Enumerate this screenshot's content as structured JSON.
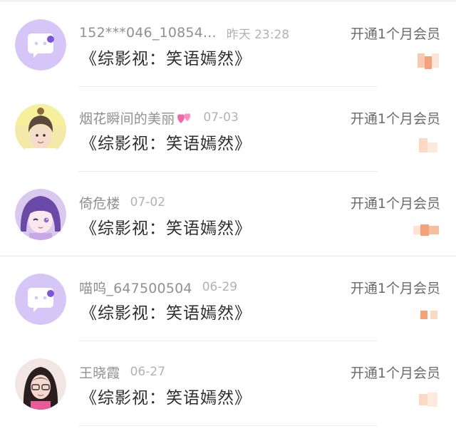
{
  "records": [
    {
      "username": "152***046_10854...",
      "timestamp": "昨天 23:28",
      "title": "《综影视：笑语嫣然》",
      "action": "开通1个月会员",
      "avatar": "default-chat-icon",
      "has_heart": false
    },
    {
      "username": "烟花瞬间的美丽",
      "timestamp": "07-03",
      "title": "《综影视：笑语嫣然》",
      "action": "开通1个月会员",
      "avatar": "user-photo",
      "has_heart": true
    },
    {
      "username": "倚危楼",
      "timestamp": "07-02",
      "title": "《综影视：笑语嫣然》",
      "action": "开通1个月会员",
      "avatar": "anime-girl",
      "has_heart": false
    },
    {
      "username": "喵呜_647500504",
      "timestamp": "06-29",
      "title": "《综影视：笑语嫣然》",
      "action": "开通1个月会员",
      "avatar": "default-chat-icon",
      "has_heart": false
    },
    {
      "username": "王晓霞",
      "timestamp": "06-27",
      "title": "《综影视：笑语嫣然》",
      "action": "开通1个月会员",
      "avatar": "user-photo",
      "has_heart": false
    }
  ],
  "colors": {
    "default_avatar_bg": "#d6c6f7",
    "username": "#909090",
    "timestamp": "#b2b2b2",
    "title": "#2d2d2d",
    "action": "#6a6a6a",
    "thumb": "#f4a27a"
  }
}
